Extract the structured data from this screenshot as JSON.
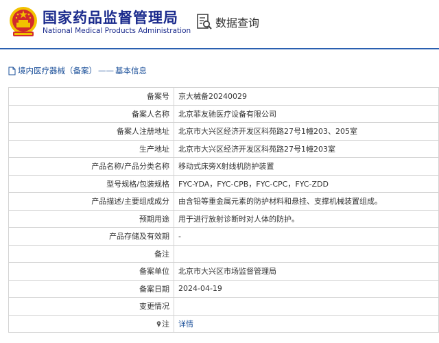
{
  "header": {
    "org_name_cn": "国家药品监督管理局",
    "org_name_en": "National Medical Products Administration",
    "query_label": "数据查询"
  },
  "breadcrumb": {
    "section": "境内医疗器械（备案）",
    "separator": "——",
    "page": "基本信息"
  },
  "record": {
    "rows": [
      {
        "label": "备案号",
        "value": "京大械备20240029"
      },
      {
        "label": "备案人名称",
        "value": "北京菲友驰医疗设备有限公司"
      },
      {
        "label": "备案人注册地址",
        "value": "北京市大兴区经济开发区科苑路27号1幢203、205室"
      },
      {
        "label": "生产地址",
        "value": "北京市大兴区经济开发区科苑路27号1幢203室"
      },
      {
        "label": "产品名称/产品分类名称",
        "value": "移动式床旁X射线机防护装置"
      },
      {
        "label": "型号规格/包装规格",
        "value": "FYC-YDA，FYC-CPB，FYC-CPC，FYC-ZDD"
      },
      {
        "label": "产品描述/主要组成成分",
        "value": "由含铅等重金属元素的防护材料和悬挂、支撑机械装置组成。"
      },
      {
        "label": "预期用途",
        "value": "用于进行放射诊断时对人体的防护。"
      },
      {
        "label": "产品存储及有效期",
        "value": "-"
      },
      {
        "label": "备注",
        "value": ""
      },
      {
        "label": "备案单位",
        "value": "北京市大兴区市场监督管理局"
      },
      {
        "label": "备案日期",
        "value": "2024-04-19"
      },
      {
        "label": "变更情况",
        "value": ""
      }
    ],
    "note_label": "注",
    "note_link": "详情"
  },
  "colors": {
    "brand": "#1a2a8c",
    "link": "#1a4f99",
    "header_line": "#2a5fb0",
    "border": "#d3d3d3",
    "emblem_red": "#d22b2b",
    "emblem_gold": "#f2c200"
  },
  "icons": {
    "emblem": "national-emblem-icon",
    "query": "document-search-icon",
    "breadcrumb": "document-icon",
    "note": "pin-icon"
  }
}
